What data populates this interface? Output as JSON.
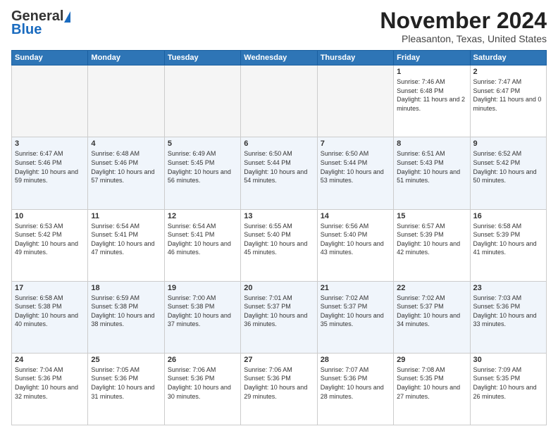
{
  "header": {
    "logo_general": "General",
    "logo_blue": "Blue",
    "month_title": "November 2024",
    "location": "Pleasanton, Texas, United States"
  },
  "weekdays": [
    "Sunday",
    "Monday",
    "Tuesday",
    "Wednesday",
    "Thursday",
    "Friday",
    "Saturday"
  ],
  "weeks": [
    [
      {
        "day": "",
        "sunrise": "",
        "sunset": "",
        "daylight": "",
        "empty": true
      },
      {
        "day": "",
        "sunrise": "",
        "sunset": "",
        "daylight": "",
        "empty": true
      },
      {
        "day": "",
        "sunrise": "",
        "sunset": "",
        "daylight": "",
        "empty": true
      },
      {
        "day": "",
        "sunrise": "",
        "sunset": "",
        "daylight": "",
        "empty": true
      },
      {
        "day": "",
        "sunrise": "",
        "sunset": "",
        "daylight": "",
        "empty": true
      },
      {
        "day": "1",
        "sunrise": "Sunrise: 7:46 AM",
        "sunset": "Sunset: 6:48 PM",
        "daylight": "Daylight: 11 hours and 2 minutes.",
        "empty": false
      },
      {
        "day": "2",
        "sunrise": "Sunrise: 7:47 AM",
        "sunset": "Sunset: 6:47 PM",
        "daylight": "Daylight: 11 hours and 0 minutes.",
        "empty": false
      }
    ],
    [
      {
        "day": "3",
        "sunrise": "Sunrise: 6:47 AM",
        "sunset": "Sunset: 5:46 PM",
        "daylight": "Daylight: 10 hours and 59 minutes.",
        "empty": false
      },
      {
        "day": "4",
        "sunrise": "Sunrise: 6:48 AM",
        "sunset": "Sunset: 5:46 PM",
        "daylight": "Daylight: 10 hours and 57 minutes.",
        "empty": false
      },
      {
        "day": "5",
        "sunrise": "Sunrise: 6:49 AM",
        "sunset": "Sunset: 5:45 PM",
        "daylight": "Daylight: 10 hours and 56 minutes.",
        "empty": false
      },
      {
        "day": "6",
        "sunrise": "Sunrise: 6:50 AM",
        "sunset": "Sunset: 5:44 PM",
        "daylight": "Daylight: 10 hours and 54 minutes.",
        "empty": false
      },
      {
        "day": "7",
        "sunrise": "Sunrise: 6:50 AM",
        "sunset": "Sunset: 5:44 PM",
        "daylight": "Daylight: 10 hours and 53 minutes.",
        "empty": false
      },
      {
        "day": "8",
        "sunrise": "Sunrise: 6:51 AM",
        "sunset": "Sunset: 5:43 PM",
        "daylight": "Daylight: 10 hours and 51 minutes.",
        "empty": false
      },
      {
        "day": "9",
        "sunrise": "Sunrise: 6:52 AM",
        "sunset": "Sunset: 5:42 PM",
        "daylight": "Daylight: 10 hours and 50 minutes.",
        "empty": false
      }
    ],
    [
      {
        "day": "10",
        "sunrise": "Sunrise: 6:53 AM",
        "sunset": "Sunset: 5:42 PM",
        "daylight": "Daylight: 10 hours and 49 minutes.",
        "empty": false
      },
      {
        "day": "11",
        "sunrise": "Sunrise: 6:54 AM",
        "sunset": "Sunset: 5:41 PM",
        "daylight": "Daylight: 10 hours and 47 minutes.",
        "empty": false
      },
      {
        "day": "12",
        "sunrise": "Sunrise: 6:54 AM",
        "sunset": "Sunset: 5:41 PM",
        "daylight": "Daylight: 10 hours and 46 minutes.",
        "empty": false
      },
      {
        "day": "13",
        "sunrise": "Sunrise: 6:55 AM",
        "sunset": "Sunset: 5:40 PM",
        "daylight": "Daylight: 10 hours and 45 minutes.",
        "empty": false
      },
      {
        "day": "14",
        "sunrise": "Sunrise: 6:56 AM",
        "sunset": "Sunset: 5:40 PM",
        "daylight": "Daylight: 10 hours and 43 minutes.",
        "empty": false
      },
      {
        "day": "15",
        "sunrise": "Sunrise: 6:57 AM",
        "sunset": "Sunset: 5:39 PM",
        "daylight": "Daylight: 10 hours and 42 minutes.",
        "empty": false
      },
      {
        "day": "16",
        "sunrise": "Sunrise: 6:58 AM",
        "sunset": "Sunset: 5:39 PM",
        "daylight": "Daylight: 10 hours and 41 minutes.",
        "empty": false
      }
    ],
    [
      {
        "day": "17",
        "sunrise": "Sunrise: 6:58 AM",
        "sunset": "Sunset: 5:38 PM",
        "daylight": "Daylight: 10 hours and 40 minutes.",
        "empty": false
      },
      {
        "day": "18",
        "sunrise": "Sunrise: 6:59 AM",
        "sunset": "Sunset: 5:38 PM",
        "daylight": "Daylight: 10 hours and 38 minutes.",
        "empty": false
      },
      {
        "day": "19",
        "sunrise": "Sunrise: 7:00 AM",
        "sunset": "Sunset: 5:38 PM",
        "daylight": "Daylight: 10 hours and 37 minutes.",
        "empty": false
      },
      {
        "day": "20",
        "sunrise": "Sunrise: 7:01 AM",
        "sunset": "Sunset: 5:37 PM",
        "daylight": "Daylight: 10 hours and 36 minutes.",
        "empty": false
      },
      {
        "day": "21",
        "sunrise": "Sunrise: 7:02 AM",
        "sunset": "Sunset: 5:37 PM",
        "daylight": "Daylight: 10 hours and 35 minutes.",
        "empty": false
      },
      {
        "day": "22",
        "sunrise": "Sunrise: 7:02 AM",
        "sunset": "Sunset: 5:37 PM",
        "daylight": "Daylight: 10 hours and 34 minutes.",
        "empty": false
      },
      {
        "day": "23",
        "sunrise": "Sunrise: 7:03 AM",
        "sunset": "Sunset: 5:36 PM",
        "daylight": "Daylight: 10 hours and 33 minutes.",
        "empty": false
      }
    ],
    [
      {
        "day": "24",
        "sunrise": "Sunrise: 7:04 AM",
        "sunset": "Sunset: 5:36 PM",
        "daylight": "Daylight: 10 hours and 32 minutes.",
        "empty": false
      },
      {
        "day": "25",
        "sunrise": "Sunrise: 7:05 AM",
        "sunset": "Sunset: 5:36 PM",
        "daylight": "Daylight: 10 hours and 31 minutes.",
        "empty": false
      },
      {
        "day": "26",
        "sunrise": "Sunrise: 7:06 AM",
        "sunset": "Sunset: 5:36 PM",
        "daylight": "Daylight: 10 hours and 30 minutes.",
        "empty": false
      },
      {
        "day": "27",
        "sunrise": "Sunrise: 7:06 AM",
        "sunset": "Sunset: 5:36 PM",
        "daylight": "Daylight: 10 hours and 29 minutes.",
        "empty": false
      },
      {
        "day": "28",
        "sunrise": "Sunrise: 7:07 AM",
        "sunset": "Sunset: 5:36 PM",
        "daylight": "Daylight: 10 hours and 28 minutes.",
        "empty": false
      },
      {
        "day": "29",
        "sunrise": "Sunrise: 7:08 AM",
        "sunset": "Sunset: 5:35 PM",
        "daylight": "Daylight: 10 hours and 27 minutes.",
        "empty": false
      },
      {
        "day": "30",
        "sunrise": "Sunrise: 7:09 AM",
        "sunset": "Sunset: 5:35 PM",
        "daylight": "Daylight: 10 hours and 26 minutes.",
        "empty": false
      }
    ]
  ]
}
